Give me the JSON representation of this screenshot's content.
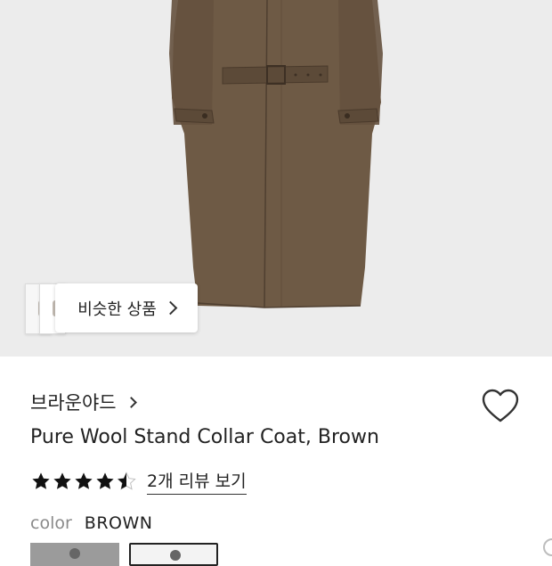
{
  "product_image": {
    "alt": "brown wool stand collar coat"
  },
  "similar_products": {
    "label": "비슷한 상품",
    "icon": "chevron-right-icon"
  },
  "brand": {
    "name": "브라운야드",
    "icon": "chevron-right-icon"
  },
  "wishlist": {
    "icon": "heart-icon"
  },
  "product": {
    "title": "Pure Wool Stand Collar Coat, Brown"
  },
  "rating": {
    "value": 4.5,
    "max": 5,
    "review_link": "2개 리뷰 보기"
  },
  "color": {
    "label": "color",
    "value": "BROWN"
  },
  "colors": {
    "coat": "#6e5a45",
    "hero_bg": "#ececec",
    "star": "#111111",
    "heart_stroke": "#333333"
  }
}
